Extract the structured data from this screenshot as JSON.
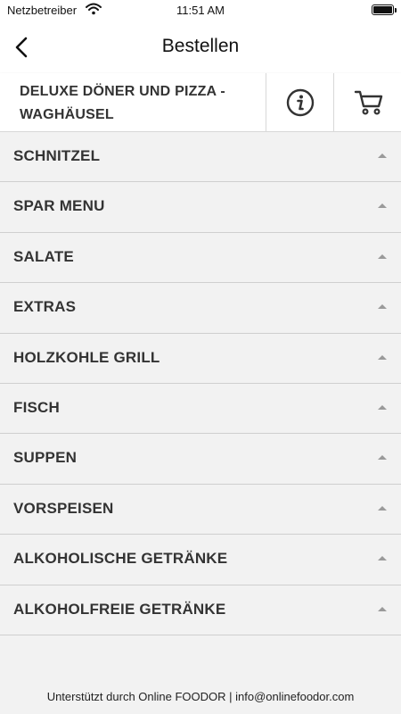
{
  "status_bar": {
    "carrier": "Netzbetreiber",
    "time": "11:51 AM",
    "battery_level": 1.0
  },
  "nav": {
    "title": "Bestellen",
    "back_icon": "chevron-left-icon"
  },
  "restaurant": {
    "name": "DELUXE DÖNER UND PIZZA - WAGHÄUSEL",
    "info_icon": "info-icon",
    "cart_icon": "cart-icon"
  },
  "categories": [
    "SCHNITZEL",
    "SPAR MENU",
    "SALATE",
    "EXTRAS",
    "HOLZKOHLE GRILL",
    "FISCH",
    "SUPPEN",
    "VORSPEISEN",
    "ALKOHOLISCHE GETRÄNKE",
    "ALKOHOLFREIE GETRÄNKE"
  ],
  "footer": {
    "text": "Unterstützt durch Online FOODOR | info@onlinefoodor.com"
  },
  "colors": {
    "background": "#f2f2f2",
    "surface": "#ffffff",
    "text": "#333333",
    "divider": "#cfcfcf"
  }
}
